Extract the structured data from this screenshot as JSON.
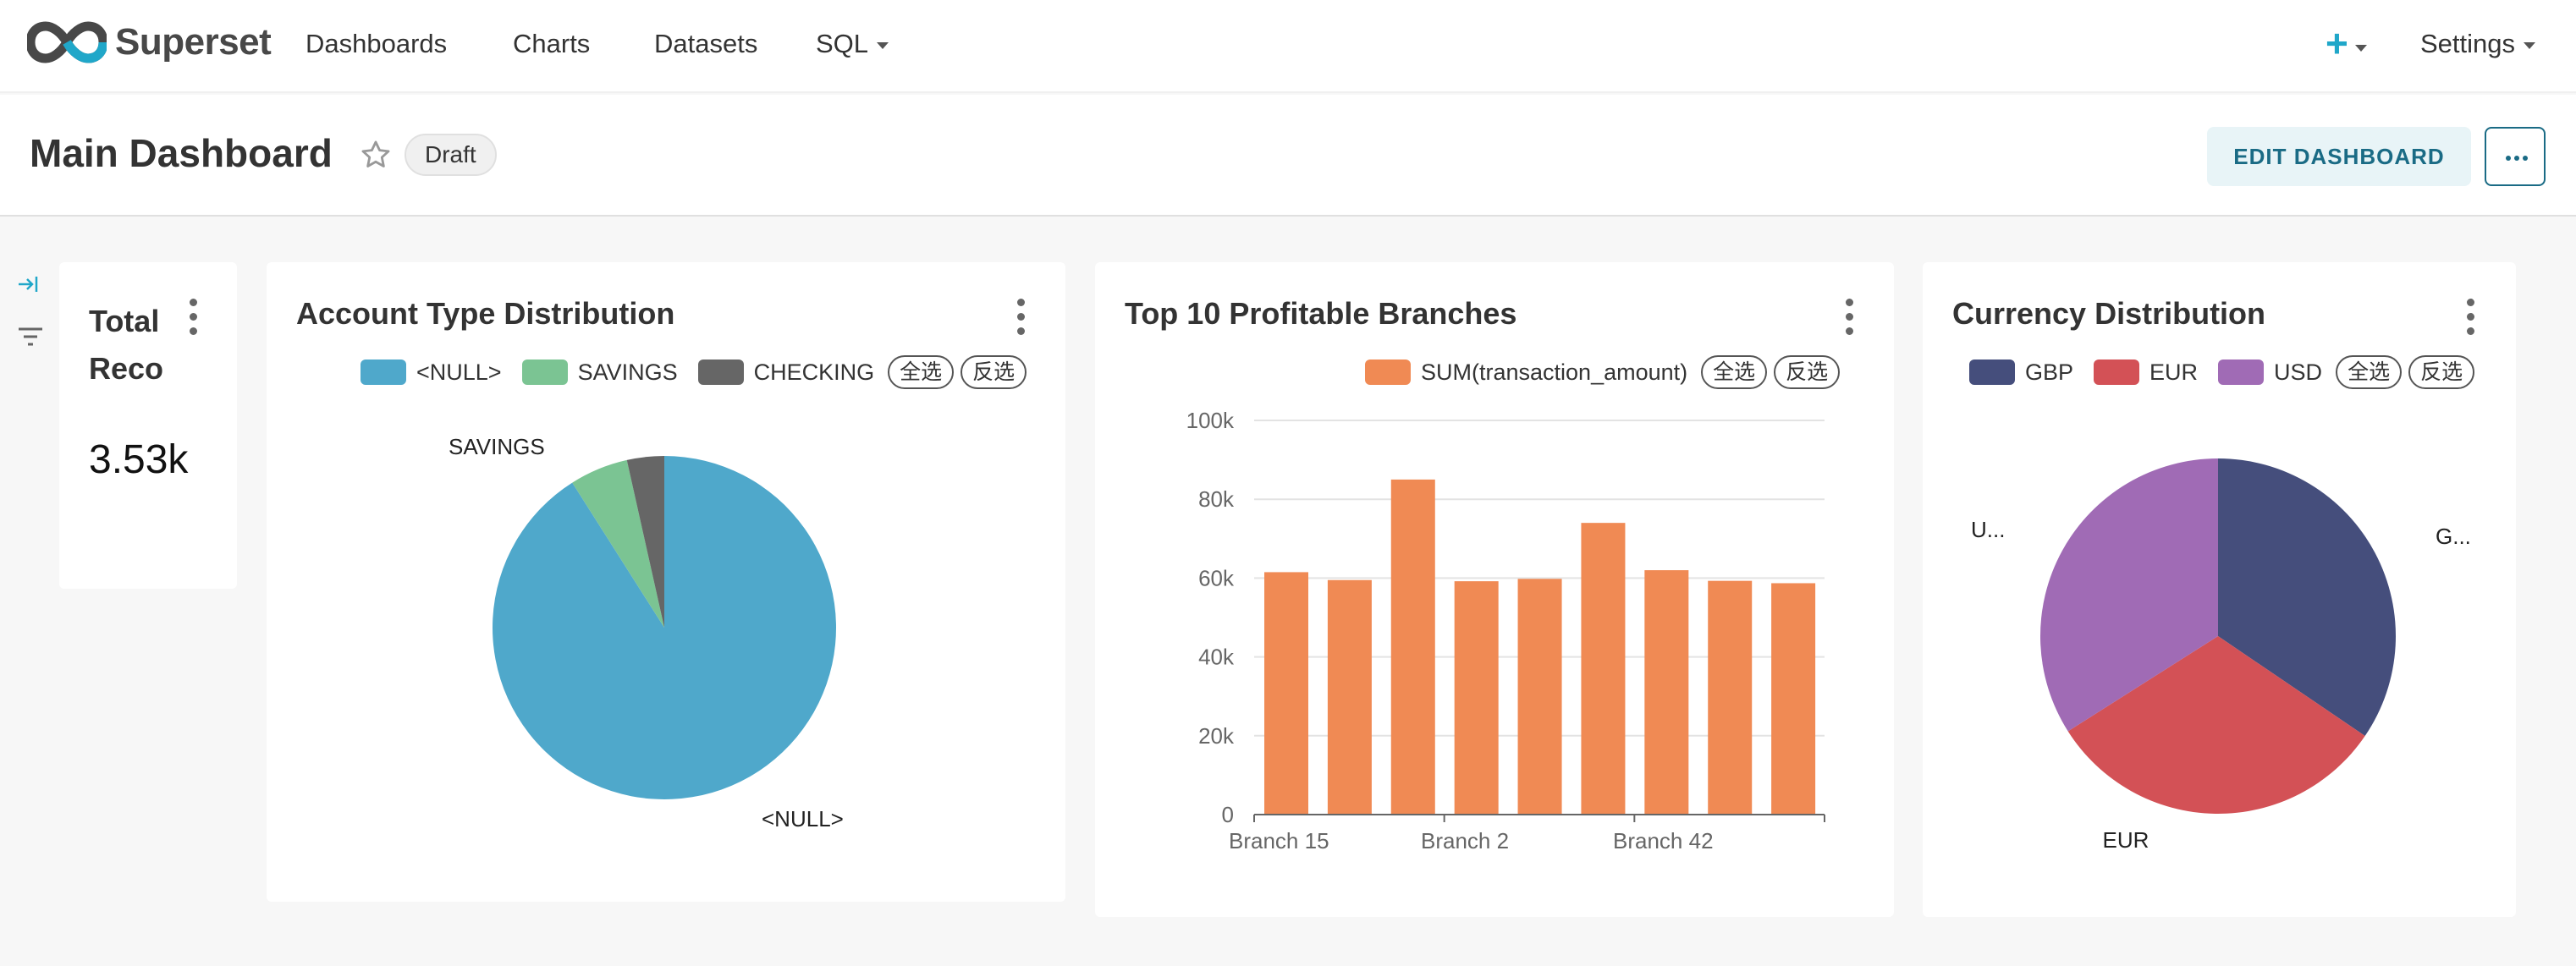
{
  "app": {
    "brand": "Superset",
    "nav": [
      "Dashboards",
      "Charts",
      "Datasets",
      "SQL"
    ],
    "plus": "+",
    "settings": "Settings"
  },
  "dashboard": {
    "title": "Main Dashboard",
    "status": "Draft",
    "edit_label": "EDIT DASHBOARD"
  },
  "filters": {
    "select_all": "全选",
    "invert": "反选"
  },
  "colors": {
    "accent": "#20a7c9",
    "null": "#4fa8cb",
    "savings": "#7bc493",
    "checking": "#666666",
    "bar": "#f08a54",
    "gbp": "#454e7c",
    "eur": "#d35156",
    "usd": "#a06bb5"
  },
  "cards": {
    "total": {
      "title_line1": "Total",
      "title_line2": "Reco",
      "value": "3.53k"
    },
    "account": {
      "title": "Account Type Distribution",
      "legend": [
        "<NULL>",
        "SAVINGS",
        "CHECKING"
      ]
    },
    "branches": {
      "title": "Top 10 Profitable Branches",
      "legend": [
        "SUM(transaction_amount)"
      ]
    },
    "currency": {
      "title": "Currency Distribution",
      "legend": [
        "GBP",
        "EUR",
        "USD"
      ]
    }
  },
  "chart_data": [
    {
      "type": "pie",
      "title": "Account Type Distribution",
      "labels": [
        "<NULL>",
        "SAVINGS",
        "CHECKING"
      ],
      "values": [
        91,
        5.5,
        3.5
      ],
      "slice_labels": [
        "<NULL>",
        "SAVINGS"
      ]
    },
    {
      "type": "bar",
      "title": "Top 10 Profitable Branches",
      "series": [
        {
          "name": "SUM(transaction_amount)",
          "values": [
            61500,
            59500,
            85000,
            59200,
            59800,
            74000,
            62000,
            59300,
            58700
          ]
        }
      ],
      "tick_labels": [
        "Branch 15",
        "Branch 2",
        "Branch 42"
      ],
      "y_ticks": [
        "0",
        "20k",
        "40k",
        "60k",
        "80k",
        "100k"
      ],
      "ylim": [
        0,
        100000
      ],
      "grid": true
    },
    {
      "type": "pie",
      "title": "Currency Distribution",
      "labels": [
        "GBP",
        "EUR",
        "USD"
      ],
      "values": [
        34.5,
        31.5,
        34
      ],
      "slice_labels": [
        "G...",
        "EUR",
        "U..."
      ]
    }
  ]
}
